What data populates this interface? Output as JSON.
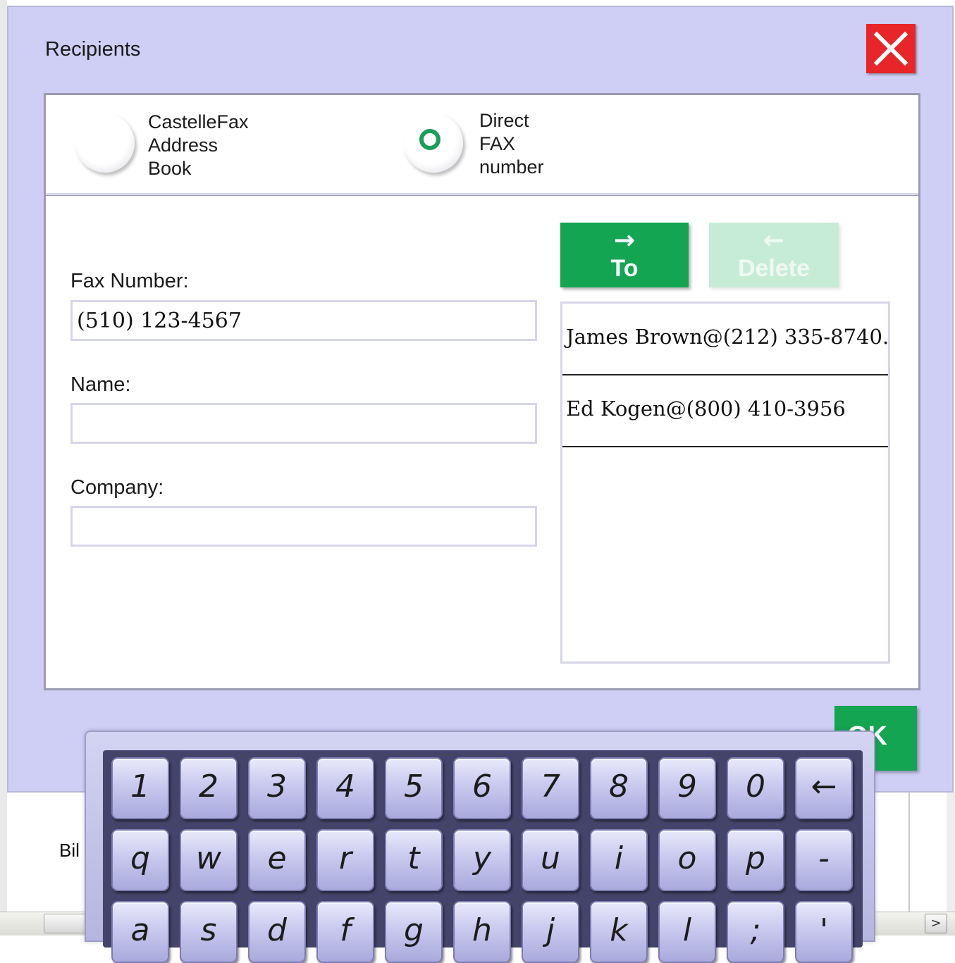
{
  "background": {
    "partial_label": "Bil",
    "scroll_arrow": ">"
  },
  "dialog": {
    "title": "Recipients",
    "close_icon": "close-icon",
    "modes": {
      "address_book_label": "CastelleFax\nAddress\nBook",
      "direct_fax_label": "Direct\nFAX\nnumber",
      "selected": "direct_fax"
    },
    "form": {
      "fax_number_label": "Fax Number:",
      "fax_number_value": "(510) 123-4567",
      "name_label": "Name:",
      "name_value": "",
      "company_label": "Company:",
      "company_value": ""
    },
    "to_button": {
      "arrow": "→",
      "label": "To"
    },
    "delete_button": {
      "arrow": "←",
      "label": "Delete"
    },
    "recipients": [
      "James Brown@(212) 335-8740...",
      "Ed Kogen@(800) 410-3956"
    ],
    "ok_label": "OK"
  },
  "keyboard": {
    "rows": [
      [
        "1",
        "2",
        "3",
        "4",
        "5",
        "6",
        "7",
        "8",
        "9",
        "0",
        "←"
      ],
      [
        "q",
        "w",
        "e",
        "r",
        "t",
        "y",
        "u",
        "i",
        "o",
        "p",
        "-"
      ],
      [
        "a",
        "s",
        "d",
        "f",
        "g",
        "h",
        "j",
        "k",
        "l",
        ";",
        "'"
      ]
    ]
  },
  "colors": {
    "dialog_bg": "#cfcff6",
    "accent_green": "#13a552",
    "close_red": "#e8262a"
  }
}
